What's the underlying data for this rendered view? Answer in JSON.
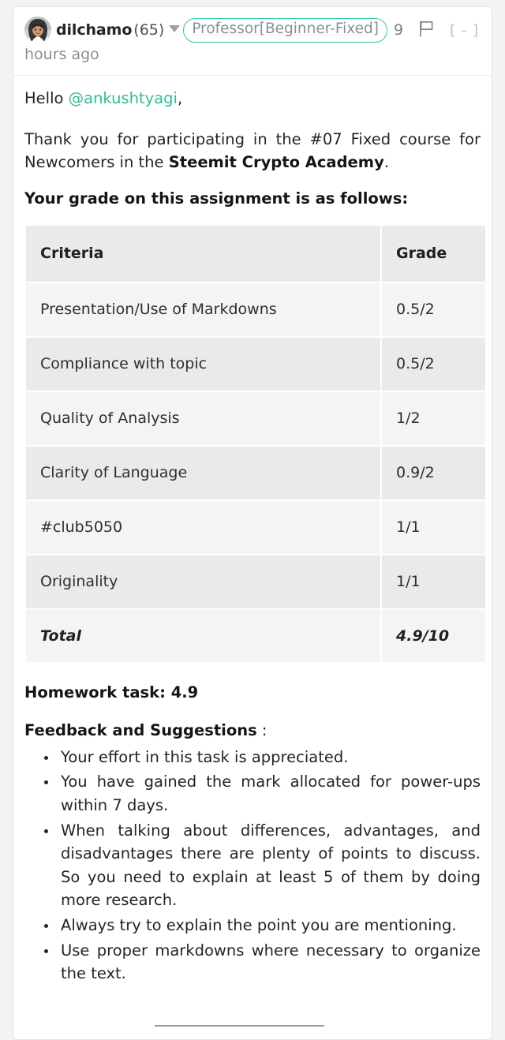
{
  "comment": {
    "author": "dilchamo",
    "reputation": "(65)",
    "role_tag": "Professor[Beginner-Fixed]",
    "vote_count": "9",
    "collapse_toggle": "[ - ]",
    "timestamp": "hours ago",
    "avatar_alt": "dilchamo-avatar"
  },
  "body": {
    "greeting_prefix": "Hello ",
    "mention": "@ankushtyagi",
    "greeting_suffix": ",",
    "intro_part1": "Thank you for participating in the #07 Fixed course for Newcomers in the ",
    "intro_bold": "Steemit Crypto Academy",
    "intro_part2": ".",
    "grade_lead": "Your grade on this assignment is as follows:"
  },
  "grade_table": {
    "columns": [
      "Criteria",
      "Grade"
    ],
    "rows": [
      {
        "criteria": "Presentation/Use of Markdowns",
        "grade": "0.5/2",
        "is_link": false
      },
      {
        "criteria": "Compliance with topic",
        "grade": "0.5/2",
        "is_link": false
      },
      {
        "criteria": "Quality of Analysis",
        "grade": "1/2",
        "is_link": false
      },
      {
        "criteria": "Clarity of Language",
        "grade": "0.9/2",
        "is_link": false
      },
      {
        "criteria": "#club5050",
        "grade": "1/1",
        "is_link": true
      },
      {
        "criteria": "Originality",
        "grade": "1/1",
        "is_link": false
      }
    ],
    "total_label": "Total",
    "total_value": "4.9/10"
  },
  "feedback": {
    "homework_total": "Homework task: 4.9",
    "heading": "Feedback and Suggestions",
    "heading_colon": " :",
    "items": [
      "Your effort in this task is appreciated.",
      "You have gained the mark allocated for power-ups within 7 days.",
      "When talking about differences, advantages, and disadvantages there are plenty of points to discuss. So you need to explain at least 5 of them by doing more research.",
      "Always try to explain the point you are mentioning.",
      "Use proper markdowns where necessary to organize the text."
    ]
  },
  "colors": {
    "accent_green": "#2fbd96",
    "tag_border": "#31c9a0",
    "page_bg": "#f3f3f3",
    "card_bg": "#ffffff",
    "row_light": "#f4f4f4",
    "row_dark": "#eaeaea",
    "text": "#222528",
    "muted": "#8a8f94"
  }
}
